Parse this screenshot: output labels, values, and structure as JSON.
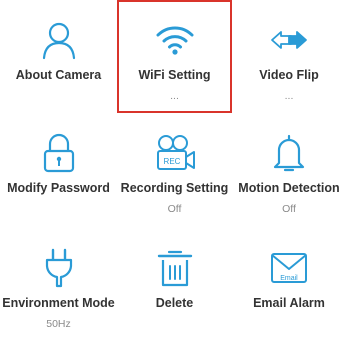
{
  "accent_color": "#2a9bd6",
  "selection_color": "#d9342b",
  "items": [
    {
      "label": "About Camera",
      "sub": "",
      "icon": "user-icon"
    },
    {
      "label": "WiFi Setting",
      "sub": "...",
      "icon": "wifi-icon",
      "selected": true
    },
    {
      "label": "Video Flip",
      "sub": "...",
      "icon": "flip-arrows-icon"
    },
    {
      "label": "Modify Password",
      "sub": "",
      "icon": "lock-icon"
    },
    {
      "label": "Recording Setting",
      "sub": "Off",
      "icon": "rec-camera-icon",
      "icon_text": "REC"
    },
    {
      "label": "Motion Detection",
      "sub": "Off",
      "icon": "bell-icon"
    },
    {
      "label": "Environment Mode",
      "sub": "50Hz",
      "icon": "plug-icon"
    },
    {
      "label": "Delete",
      "sub": "",
      "icon": "trash-icon"
    },
    {
      "label": "Email Alarm",
      "sub": "",
      "icon": "email-icon",
      "icon_text": "Email"
    }
  ]
}
